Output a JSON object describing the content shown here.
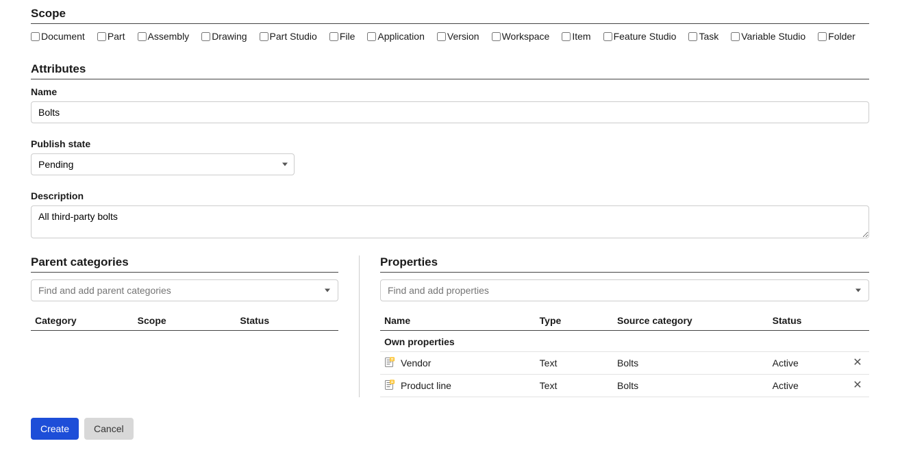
{
  "scope": {
    "title": "Scope",
    "items": [
      {
        "label": "Document",
        "checked": false
      },
      {
        "label": "Part",
        "checked": false
      },
      {
        "label": "Assembly",
        "checked": false
      },
      {
        "label": "Drawing",
        "checked": false
      },
      {
        "label": "Part Studio",
        "checked": false
      },
      {
        "label": "File",
        "checked": false
      },
      {
        "label": "Application",
        "checked": false
      },
      {
        "label": "Version",
        "checked": false
      },
      {
        "label": "Workspace",
        "checked": false
      },
      {
        "label": "Item",
        "checked": false
      },
      {
        "label": "Feature Studio",
        "checked": false
      },
      {
        "label": "Task",
        "checked": false
      },
      {
        "label": "Variable Studio",
        "checked": false
      },
      {
        "label": "Folder",
        "checked": false
      }
    ]
  },
  "attributes": {
    "title": "Attributes",
    "name_label": "Name",
    "name_value": "Bolts",
    "publish_label": "Publish state",
    "publish_value": "Pending",
    "description_label": "Description",
    "description_value": "All third-party bolts"
  },
  "parent": {
    "title": "Parent categories",
    "placeholder": "Find and add parent categories",
    "columns": {
      "category": "Category",
      "scope": "Scope",
      "status": "Status"
    },
    "rows": []
  },
  "properties": {
    "title": "Properties",
    "placeholder": "Find and add properties",
    "columns": {
      "name": "Name",
      "type": "Type",
      "source": "Source category",
      "status": "Status"
    },
    "group_label": "Own properties",
    "rows": [
      {
        "name": "Vendor",
        "type": "Text",
        "source": "Bolts",
        "status": "Active"
      },
      {
        "name": "Product line",
        "type": "Text",
        "source": "Bolts",
        "status": "Active"
      }
    ]
  },
  "buttons": {
    "create": "Create",
    "cancel": "Cancel"
  }
}
